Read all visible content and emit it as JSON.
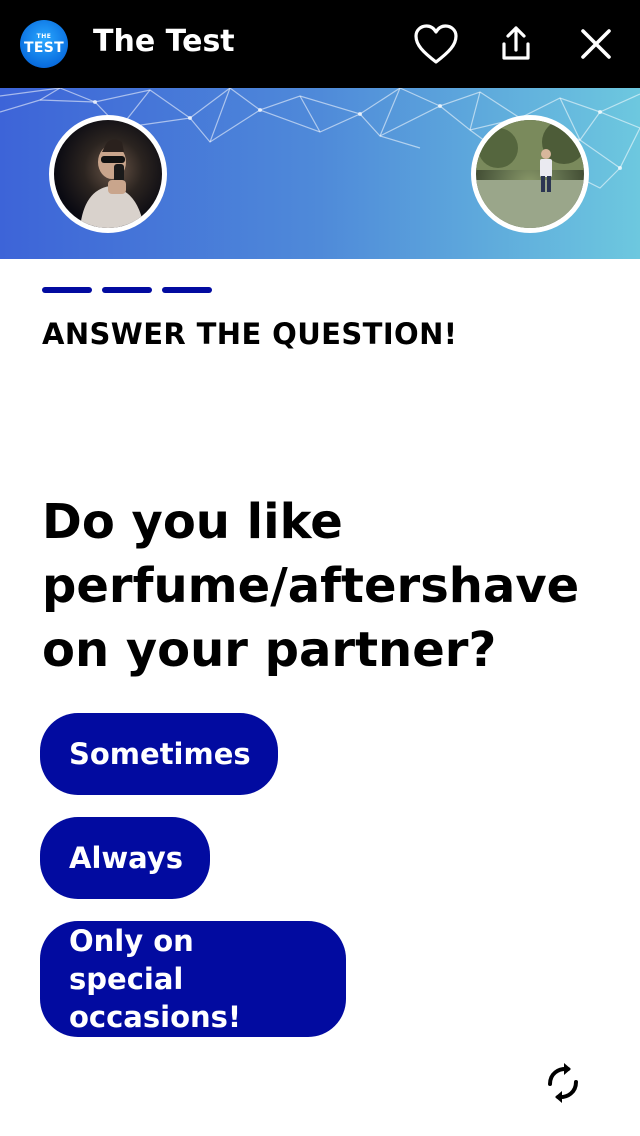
{
  "header": {
    "logo_top": "THE",
    "logo_main": "TEST",
    "title": "The Test",
    "icons": [
      "heart-icon",
      "share-icon",
      "close-icon"
    ]
  },
  "banner": {
    "gradient": [
      "#3d64d8",
      "#6dc8df"
    ]
  },
  "progress": {
    "steps": 3,
    "color": "#020ba0"
  },
  "prompt": "ANSWER THE QUESTION!",
  "question": "Do you like perfume/aftershave on your partner?",
  "answers": [
    {
      "label": "Sometimes"
    },
    {
      "label": "Always"
    },
    {
      "label": "Only on special occasions!"
    }
  ],
  "colors": {
    "accent": "#020ba0",
    "topbar": "#000000"
  }
}
